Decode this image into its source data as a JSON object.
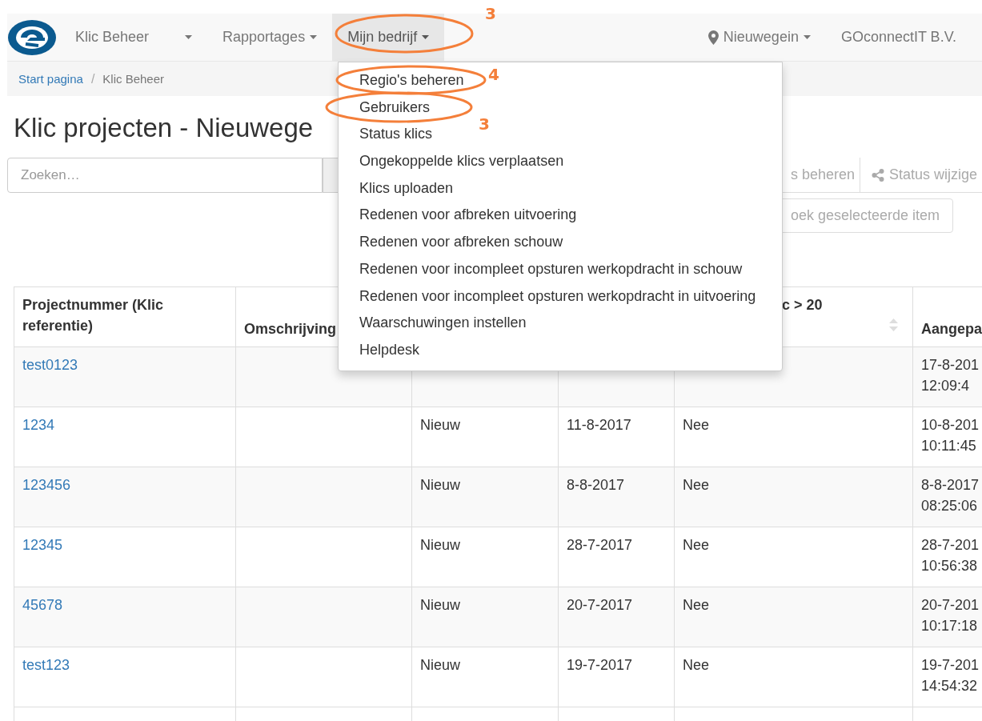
{
  "navbar": {
    "items": [
      {
        "label": "Klic Beheer",
        "selected": false,
        "kind": "spaced"
      },
      {
        "label": "Rapportages",
        "selected": false,
        "kind": "dropdown"
      },
      {
        "label": "Mijn bedrijf",
        "selected": true,
        "kind": "dropdown"
      }
    ],
    "right_items": [
      {
        "label": "Nieuwegein",
        "kind": "location"
      },
      {
        "label": "GOconnectIT B.V.",
        "kind": "plain"
      }
    ]
  },
  "breadcrumb": [
    {
      "label": "Start pagina",
      "kind": "link"
    },
    {
      "label": "/",
      "kind": "separator"
    },
    {
      "label": "Klic Beheer",
      "kind": "current"
    }
  ],
  "title": "Klic projecten - Nieuwege",
  "search": {
    "placeholder": "Zoeken…"
  },
  "toolbar": [
    {
      "label": "s beheren",
      "kind": "plain"
    },
    {
      "label": "Status wijzige",
      "kind": "share"
    }
  ],
  "secondary_button": "oek geselecteerde item",
  "dropdown": {
    "items": [
      "Regio's beheren",
      "Gebruikers",
      "Status klics",
      "Ongekoppelde klics verplaatsen",
      "Klics uploaden",
      "Redenen voor afbreken uitvoering",
      "Redenen voor afbreken schouw",
      "Redenen voor incompleet opsturen werkopdracht in schouw",
      "Redenen voor incompleet opsturen werkopdracht in uitvoering",
      "Waarschuwingen instellen",
      "Helpdesk"
    ]
  },
  "table": {
    "columns": [
      "Projectnummer (Klic referentie)",
      "Omschrijving",
      "",
      "",
      "c > 20",
      "Aangepa"
    ],
    "rows": [
      {
        "cells": [
          "test0123",
          "",
          "",
          "",
          "",
          "17-8-201\n12:09:4"
        ]
      },
      {
        "cells": [
          "1234",
          "",
          "Nieuw",
          "11-8-2017",
          "Nee",
          "10-8-201\n10:11:45"
        ]
      },
      {
        "cells": [
          "123456",
          "",
          "Nieuw",
          "8-8-2017",
          "Nee",
          "8-8-2017\n08:25:06"
        ]
      },
      {
        "cells": [
          "12345",
          "",
          "Nieuw",
          "28-7-2017",
          "Nee",
          "28-7-201\n10:56:38"
        ]
      },
      {
        "cells": [
          "45678",
          "",
          "Nieuw",
          "20-7-2017",
          "Nee",
          "20-7-201\n10:17:18"
        ]
      },
      {
        "cells": [
          "test123",
          "",
          "Nieuw",
          "19-7-2017",
          "Nee",
          "19-7-201\n14:54:32"
        ]
      }
    ]
  },
  "annotations": [
    {
      "number": "3"
    },
    {
      "number": "4"
    },
    {
      "number": "3"
    }
  ]
}
